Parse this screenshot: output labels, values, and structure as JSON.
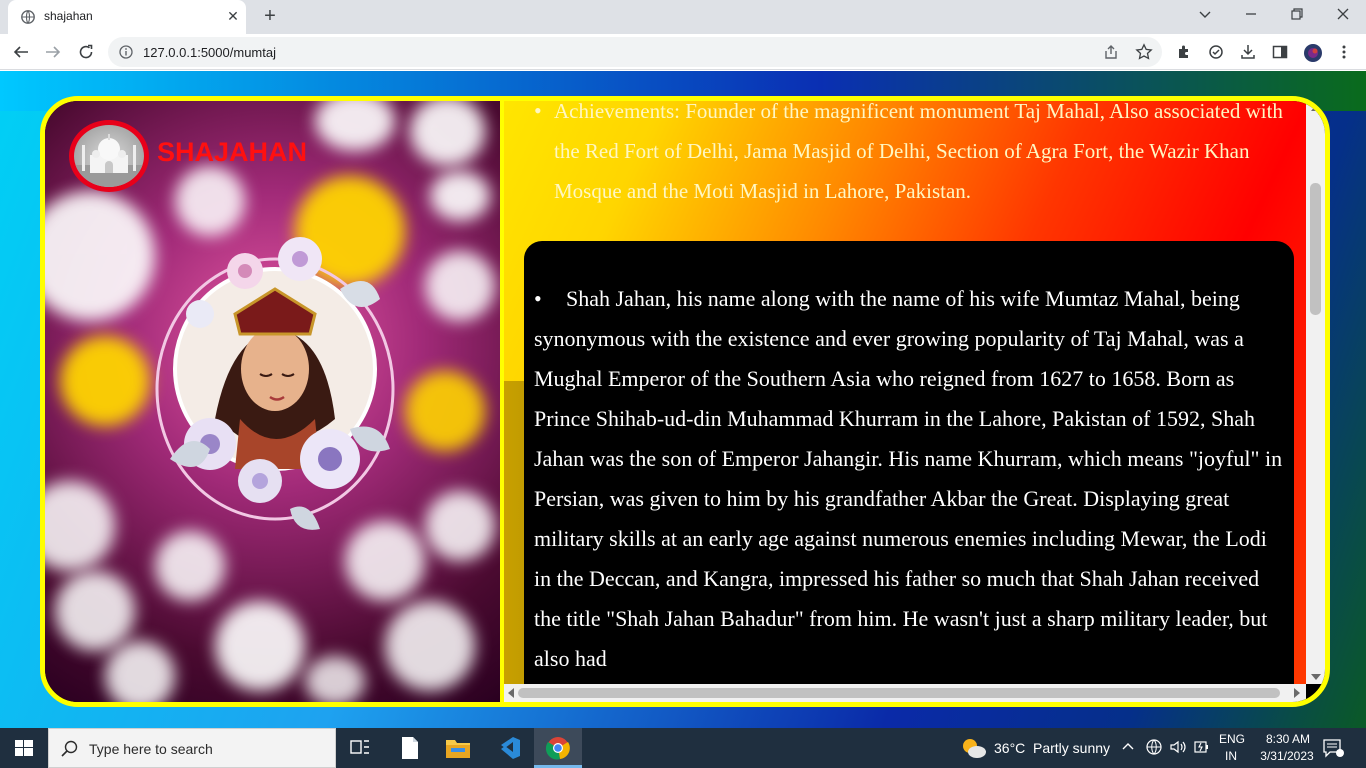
{
  "browser": {
    "tab_title": "shajahan",
    "tab_close": "✕",
    "new_tab": "+",
    "url": "127.0.0.1:5000/mumtaj"
  },
  "page": {
    "brand": "SHAJAHAN",
    "achievements_bullet": "•",
    "achievements_text": "Achievements: Founder of the magnificent monument Taj Mahal, Also associated with the Red Fort of Delhi, Jama Masjid of Delhi, Section of Agra Fort, the Wazir Khan Mosque and the Moti Masjid in Lahore, Pakistan.",
    "bio_bullet": "•",
    "bio_text": "Shah Jahan, his name along with the name of his wife Mumtaz Mahal, being synonymous with the existence and ever growing popularity of Taj Mahal, was a Mughal Emperor of the Southern Asia who reigned from 1627 to 1658. Born as Prince Shihab-ud-din Muhammad Khurram in the Lahore, Pakistan of 1592, Shah Jahan was the son of Emperor Jahangir. His name Khurram, which means \"joyful\" in Persian, was given to him by his grandfather Akbar the Great. Displaying great military skills at an early age against numerous enemies including Mewar, the Lodi in the Deccan, and Kangra, impressed his father so much that Shah Jahan received the title \"Shah Jahan Bahadur\" from him. He wasn't just a sharp military leader, but also had",
    "colors": {
      "frame_border": "#ffff00",
      "brand_red": "#ff1010"
    }
  },
  "taskbar": {
    "search_placeholder": "Type here to search",
    "weather_temp": "36°C",
    "weather_desc": "Partly sunny",
    "lang_line1": "ENG",
    "lang_line2": "IN",
    "time": "8:30 AM",
    "date": "3/31/2023"
  }
}
